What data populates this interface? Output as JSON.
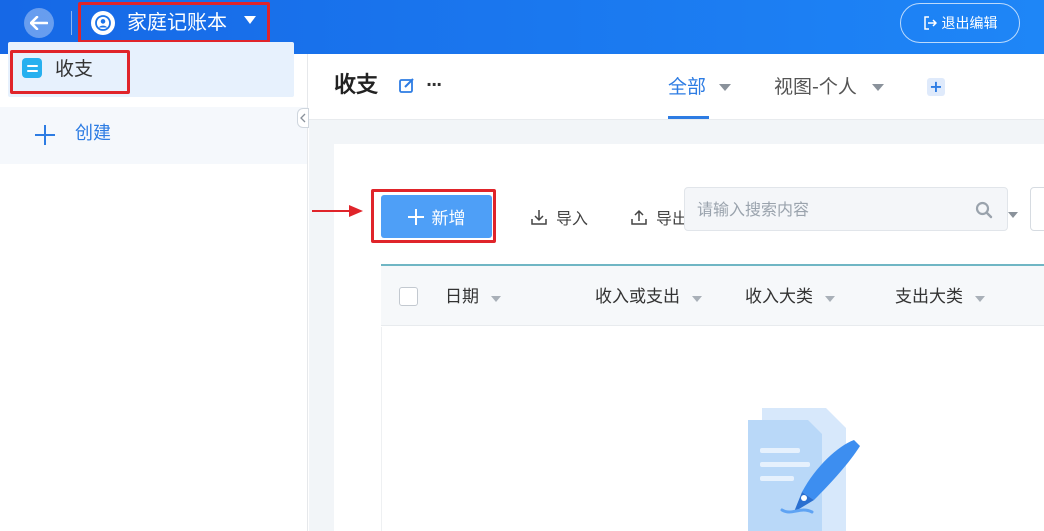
{
  "topbar": {
    "app_title": "家庭记账本",
    "exit_label": "退出编辑"
  },
  "sidebar": {
    "items": [
      {
        "label": "收支"
      }
    ],
    "create_label": "创建"
  },
  "header": {
    "page_title": "收支",
    "tabs": [
      {
        "label": "全部"
      },
      {
        "label": "视图-个人"
      }
    ]
  },
  "toolbar": {
    "add_label": "新增",
    "import_label": "导入",
    "export_label": "导出",
    "search_placeholder": "请输入搜索内容"
  },
  "table": {
    "columns": [
      "日期",
      "收入或支出",
      "收入大类",
      "支出大类"
    ]
  },
  "colors": {
    "topbar": "#1668e6",
    "accent": "#2d7ce3",
    "primary_button": "#4e9ff7",
    "annotation_red": "#e0242a"
  }
}
